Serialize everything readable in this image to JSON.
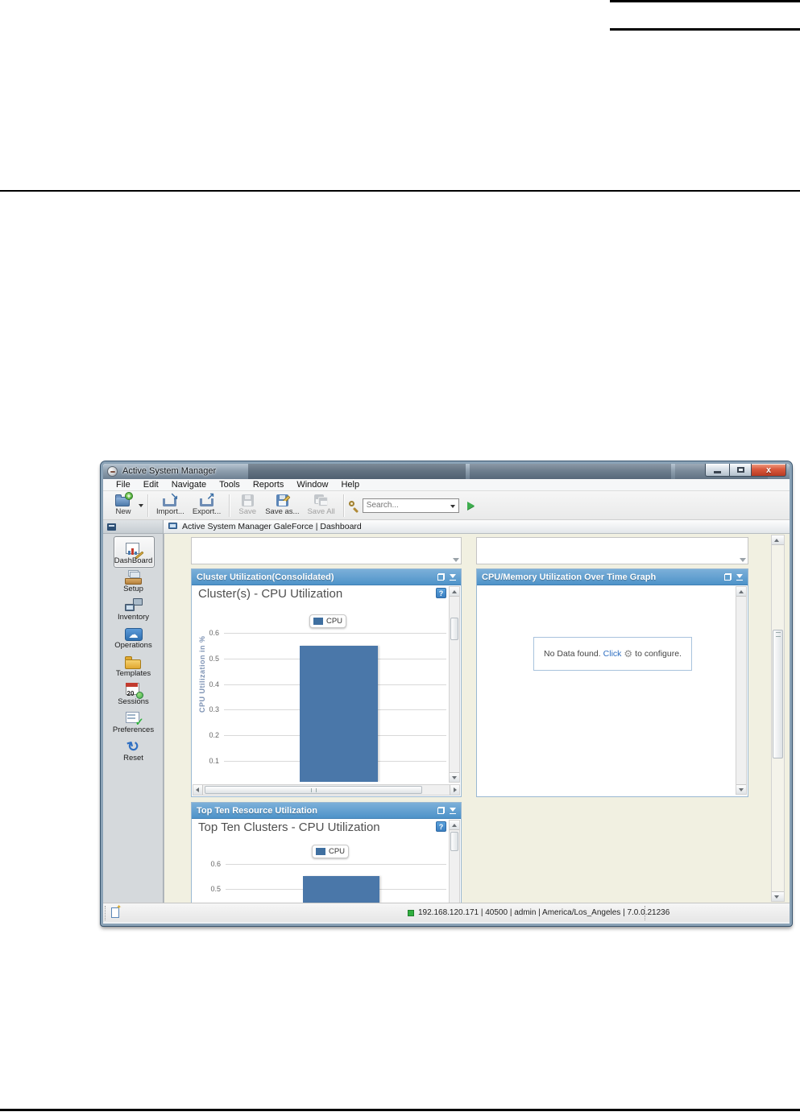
{
  "window": {
    "title": "Active System Manager",
    "menu": [
      "File",
      "Edit",
      "Navigate",
      "Tools",
      "Reports",
      "Window",
      "Help"
    ],
    "toolbar": {
      "new_label": "New",
      "import_label": "Import...",
      "export_label": "Export...",
      "save_label": "Save",
      "save_as_label": "Save as...",
      "save_all_label": "Save All",
      "search_placeholder": "Search..."
    },
    "tab_label": "Active System Manager GaleForce | Dashboard",
    "sidebar": {
      "items": [
        "DashBoard",
        "Setup",
        "Inventory",
        "Operations",
        "Templates",
        "Sessions",
        "Preferences",
        "Reset"
      ]
    },
    "panels": {
      "cluster": {
        "header": "Cluster Utilization(Consolidated)",
        "help": "?"
      },
      "cpu_memory": {
        "header": "CPU/Memory Utilization Over Time Graph",
        "no_data_pre": "No Data found.",
        "no_data_link": "Click",
        "no_data_post": "to configure."
      },
      "top_ten": {
        "header": "Top Ten Resource Utilization",
        "help": "?"
      }
    },
    "status": {
      "connection": "192.168.120.171 | 40500 | admin | America/Los_Angeles | 7.0.0.21236"
    }
  },
  "chart_data": [
    {
      "type": "bar",
      "title": "Cluster(s) - CPU Utilization",
      "xlabel": "",
      "ylabel": "CPU Utilization in %",
      "legend": [
        "CPU"
      ],
      "legend_position": "top",
      "categories": [
        ""
      ],
      "series": [
        {
          "name": "CPU",
          "values": [
            0.55
          ]
        }
      ],
      "yticks": [
        0.6,
        0.5,
        0.4,
        0.3,
        0.2,
        0.1
      ],
      "ylim_visible": [
        0.02,
        0.68
      ],
      "grid": true,
      "bar_color": "#4a77a9"
    },
    {
      "type": "bar",
      "title": "Top Ten Clusters - CPU Utilization",
      "xlabel": "",
      "ylabel": "",
      "legend": [
        "CPU"
      ],
      "legend_position": "top",
      "categories": [
        ""
      ],
      "series": [
        {
          "name": "CPU",
          "values": [
            0.55
          ]
        }
      ],
      "yticks": [
        0.6,
        0.5
      ],
      "ylim_visible": [
        0.44,
        0.645
      ],
      "grid": true,
      "bar_color": "#4a77a9"
    }
  ]
}
